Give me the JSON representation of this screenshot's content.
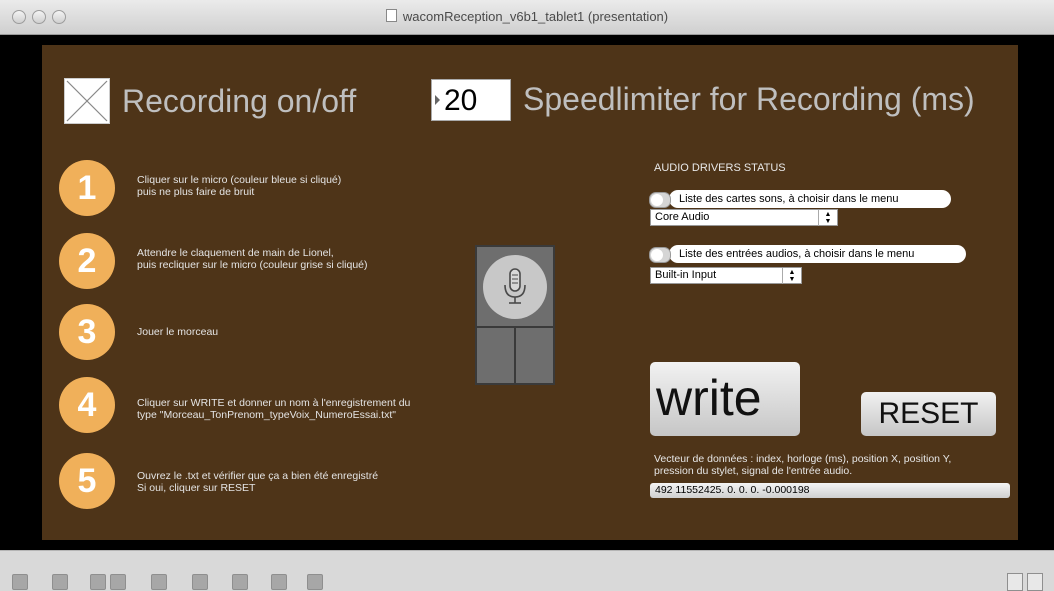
{
  "window": {
    "title": "wacomReception_v6b1_tablet1 (presentation)"
  },
  "recording": {
    "label": "Recording on/off",
    "checked": true
  },
  "speedlimiter": {
    "value": "20",
    "label": "Speedlimiter for Recording (ms)"
  },
  "steps": [
    {
      "number": "1",
      "line1": "Cliquer sur le micro (couleur bleue si cliqué)",
      "line2": "puis ne plus faire de bruit"
    },
    {
      "number": "2",
      "line1": "Attendre le claquement de main de Lionel,",
      "line2": "puis recliquer sur le micro (couleur grise si cliqué)"
    },
    {
      "number": "3",
      "line1": "Jouer le morceau",
      "line2": ""
    },
    {
      "number": "4",
      "line1": "Cliquer sur WRITE et donner un nom à l'enregistrement du",
      "line2": "type \"Morceau_TonPrenom_typeVoix_NumeroEssai.txt\""
    },
    {
      "number": "5",
      "line1": "Ouvrez le .txt et vérifier que ça a bien été enregistré",
      "line2": "Si oui, cliquer sur RESET"
    }
  ],
  "audio": {
    "status_title": "AUDIO DRIVERS STATUS",
    "sound_cards_label": "Liste des cartes sons, à choisir dans le menu",
    "sound_card_selected": "Core Audio",
    "inputs_label": "Liste des entrées audios, à choisir dans le menu",
    "input_selected": "Built-in Input"
  },
  "buttons": {
    "write": "write",
    "reset": "RESET"
  },
  "vector": {
    "label_line1": "Vecteur de données : index, horloge (ms), position X, position Y,",
    "label_line2": "pression du stylet, signal de l'entrée audio.",
    "value": "492 11552425. 0. 0. 0. -0.000198"
  },
  "icons": {
    "mic": "microphone-icon",
    "checkbox": "checkbox-x-icon"
  },
  "colors": {
    "panel": "#4e3418",
    "step_circle": "#f0b05a",
    "label_gray": "#bfbfbf"
  }
}
